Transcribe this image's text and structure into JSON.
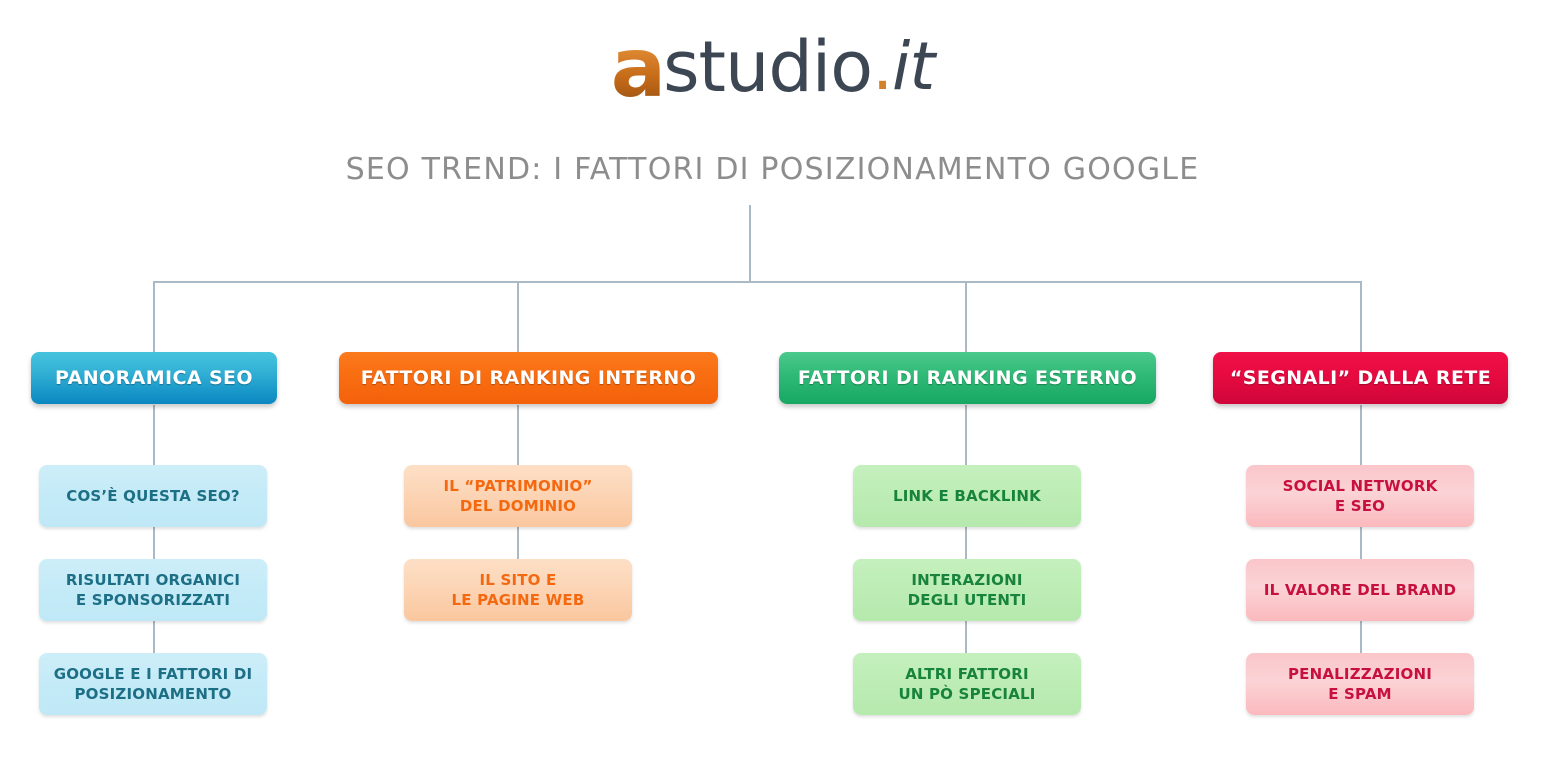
{
  "logo": {
    "mark": "a",
    "word": "studio",
    "dot": ".",
    "tld": "it",
    "full_text": "astudio.it",
    "mark_color": "#d4802a",
    "word_color": "#3c4753"
  },
  "title": "SEO TREND: I FATTORI DI POSIZIONAMENTO GOOGLE",
  "title_color": "#8d8d8d",
  "connector_color": "#aab9c6",
  "columns": [
    {
      "id": "panoramica-seo",
      "accent": "#1796c9",
      "header": "PANORAMICA SEO",
      "items": [
        "COS’È QUESTA SEO?",
        "RISULTATI ORGANICI\nE SPONSORIZZATI",
        "GOOGLE E I FATTORI DI\nPOSIZIONAMENTO"
      ]
    },
    {
      "id": "fattori-ranking-interno",
      "accent": "#f4610a",
      "header": "FATTORI DI RANKING INTERNO",
      "items": [
        "IL “PATRIMONIO”\nDEL DOMINIO",
        "IL SITO E\nLE PAGINE WEB"
      ]
    },
    {
      "id": "fattori-ranking-esterno",
      "accent": "#16a862",
      "header": "FATTORI DI RANKING ESTERNO",
      "items": [
        "LINK E BACKLINK",
        "INTERAZIONI\nDEGLI UTENTI",
        "ALTRI FATTORI\nUN PÒ SPECIALI"
      ]
    },
    {
      "id": "segnali-dalla-rete",
      "accent": "#cf063a",
      "header": "“SEGNALI” DALLA RETE",
      "items": [
        "SOCIAL NETWORK\nE SEO",
        "IL VALORE DEL BRAND",
        "PENALIZZAZIONI\nE SPAM"
      ]
    }
  ]
}
